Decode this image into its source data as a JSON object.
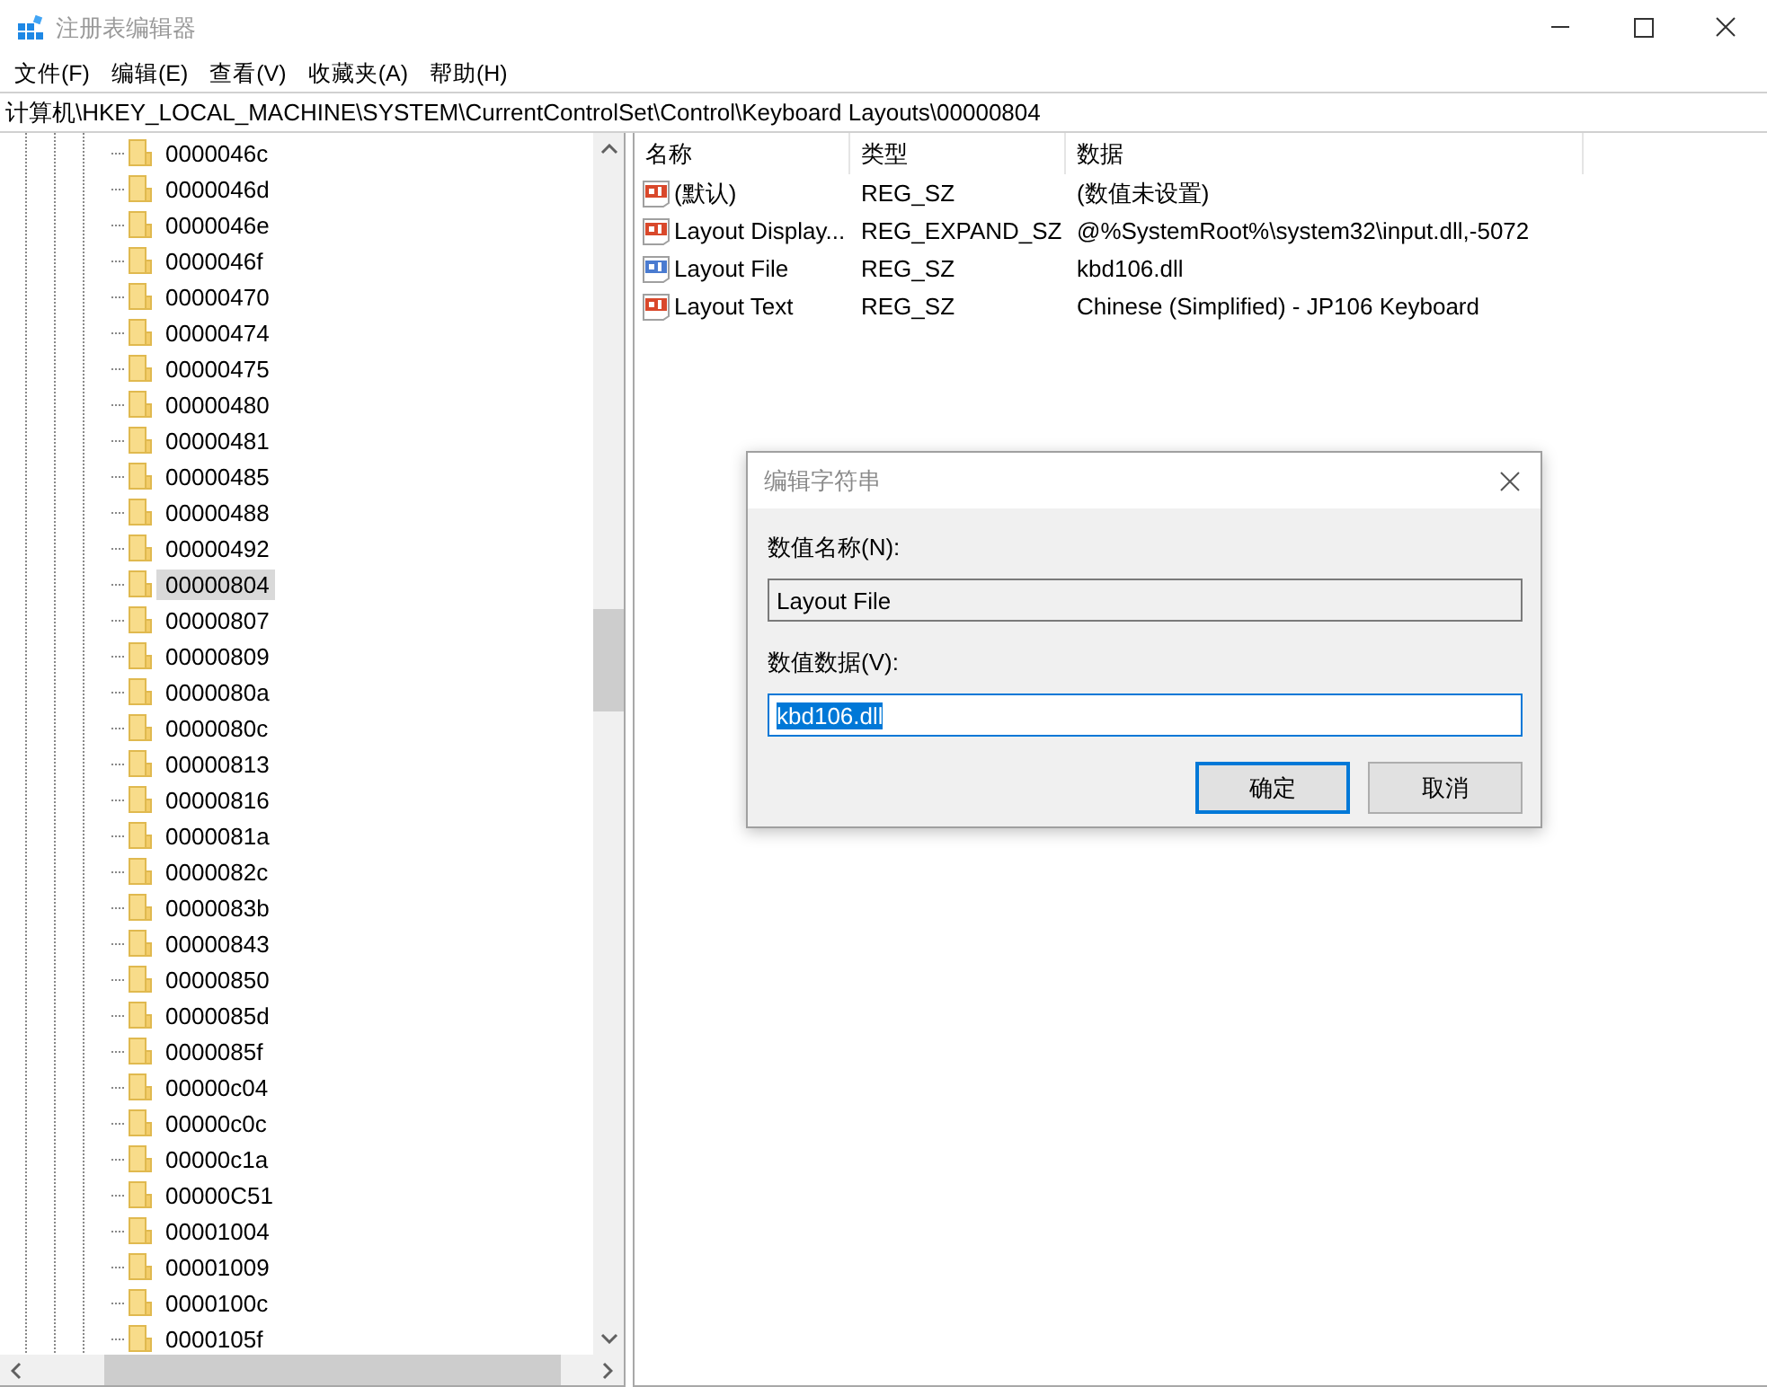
{
  "window": {
    "title": "注册表编辑器"
  },
  "menu": [
    "文件(F)",
    "编辑(E)",
    "查看(V)",
    "收藏夹(A)",
    "帮助(H)"
  ],
  "address": "计算机\\HKEY_LOCAL_MACHINE\\SYSTEM\\CurrentControlSet\\Control\\Keyboard Layouts\\00000804",
  "tree": {
    "items": [
      {
        "label": "0000046c",
        "selected": false
      },
      {
        "label": "0000046d",
        "selected": false
      },
      {
        "label": "0000046e",
        "selected": false
      },
      {
        "label": "0000046f",
        "selected": false
      },
      {
        "label": "00000470",
        "selected": false
      },
      {
        "label": "00000474",
        "selected": false
      },
      {
        "label": "00000475",
        "selected": false
      },
      {
        "label": "00000480",
        "selected": false
      },
      {
        "label": "00000481",
        "selected": false
      },
      {
        "label": "00000485",
        "selected": false
      },
      {
        "label": "00000488",
        "selected": false
      },
      {
        "label": "00000492",
        "selected": false
      },
      {
        "label": "00000804",
        "selected": true
      },
      {
        "label": "00000807",
        "selected": false
      },
      {
        "label": "00000809",
        "selected": false
      },
      {
        "label": "0000080a",
        "selected": false
      },
      {
        "label": "0000080c",
        "selected": false
      },
      {
        "label": "00000813",
        "selected": false
      },
      {
        "label": "00000816",
        "selected": false
      },
      {
        "label": "0000081a",
        "selected": false
      },
      {
        "label": "0000082c",
        "selected": false
      },
      {
        "label": "0000083b",
        "selected": false
      },
      {
        "label": "00000843",
        "selected": false
      },
      {
        "label": "00000850",
        "selected": false
      },
      {
        "label": "0000085d",
        "selected": false
      },
      {
        "label": "0000085f",
        "selected": false
      },
      {
        "label": "00000c04",
        "selected": false
      },
      {
        "label": "00000c0c",
        "selected": false
      },
      {
        "label": "00000c1a",
        "selected": false
      },
      {
        "label": "00000C51",
        "selected": false
      },
      {
        "label": "00001004",
        "selected": false
      },
      {
        "label": "00001009",
        "selected": false
      },
      {
        "label": "0000100c",
        "selected": false
      },
      {
        "label": "0000105f",
        "selected": false
      }
    ]
  },
  "table": {
    "columns": [
      "名称",
      "类型",
      "数据"
    ],
    "rows": [
      {
        "name": "(默认)",
        "type": "REG_SZ",
        "data": "(数值未设置)",
        "selected": false
      },
      {
        "name": "Layout Display...",
        "type": "REG_EXPAND_SZ",
        "data": "@%SystemRoot%\\system32\\input.dll,-5072",
        "selected": false
      },
      {
        "name": "Layout File",
        "type": "REG_SZ",
        "data": "kbd106.dll",
        "selected": true
      },
      {
        "name": "Layout Text",
        "type": "REG_SZ",
        "data": "Chinese (Simplified) - JP106 Keyboard",
        "selected": false
      }
    ]
  },
  "dialog": {
    "title": "编辑字符串",
    "name_label": "数值名称(N):",
    "name_value": "Layout File",
    "data_label": "数值数据(V):",
    "data_value": "kbd106.dll",
    "data_value_selected": true,
    "buttons": [
      {
        "label": "确定",
        "default": true
      },
      {
        "label": "取消",
        "default": false
      }
    ]
  }
}
